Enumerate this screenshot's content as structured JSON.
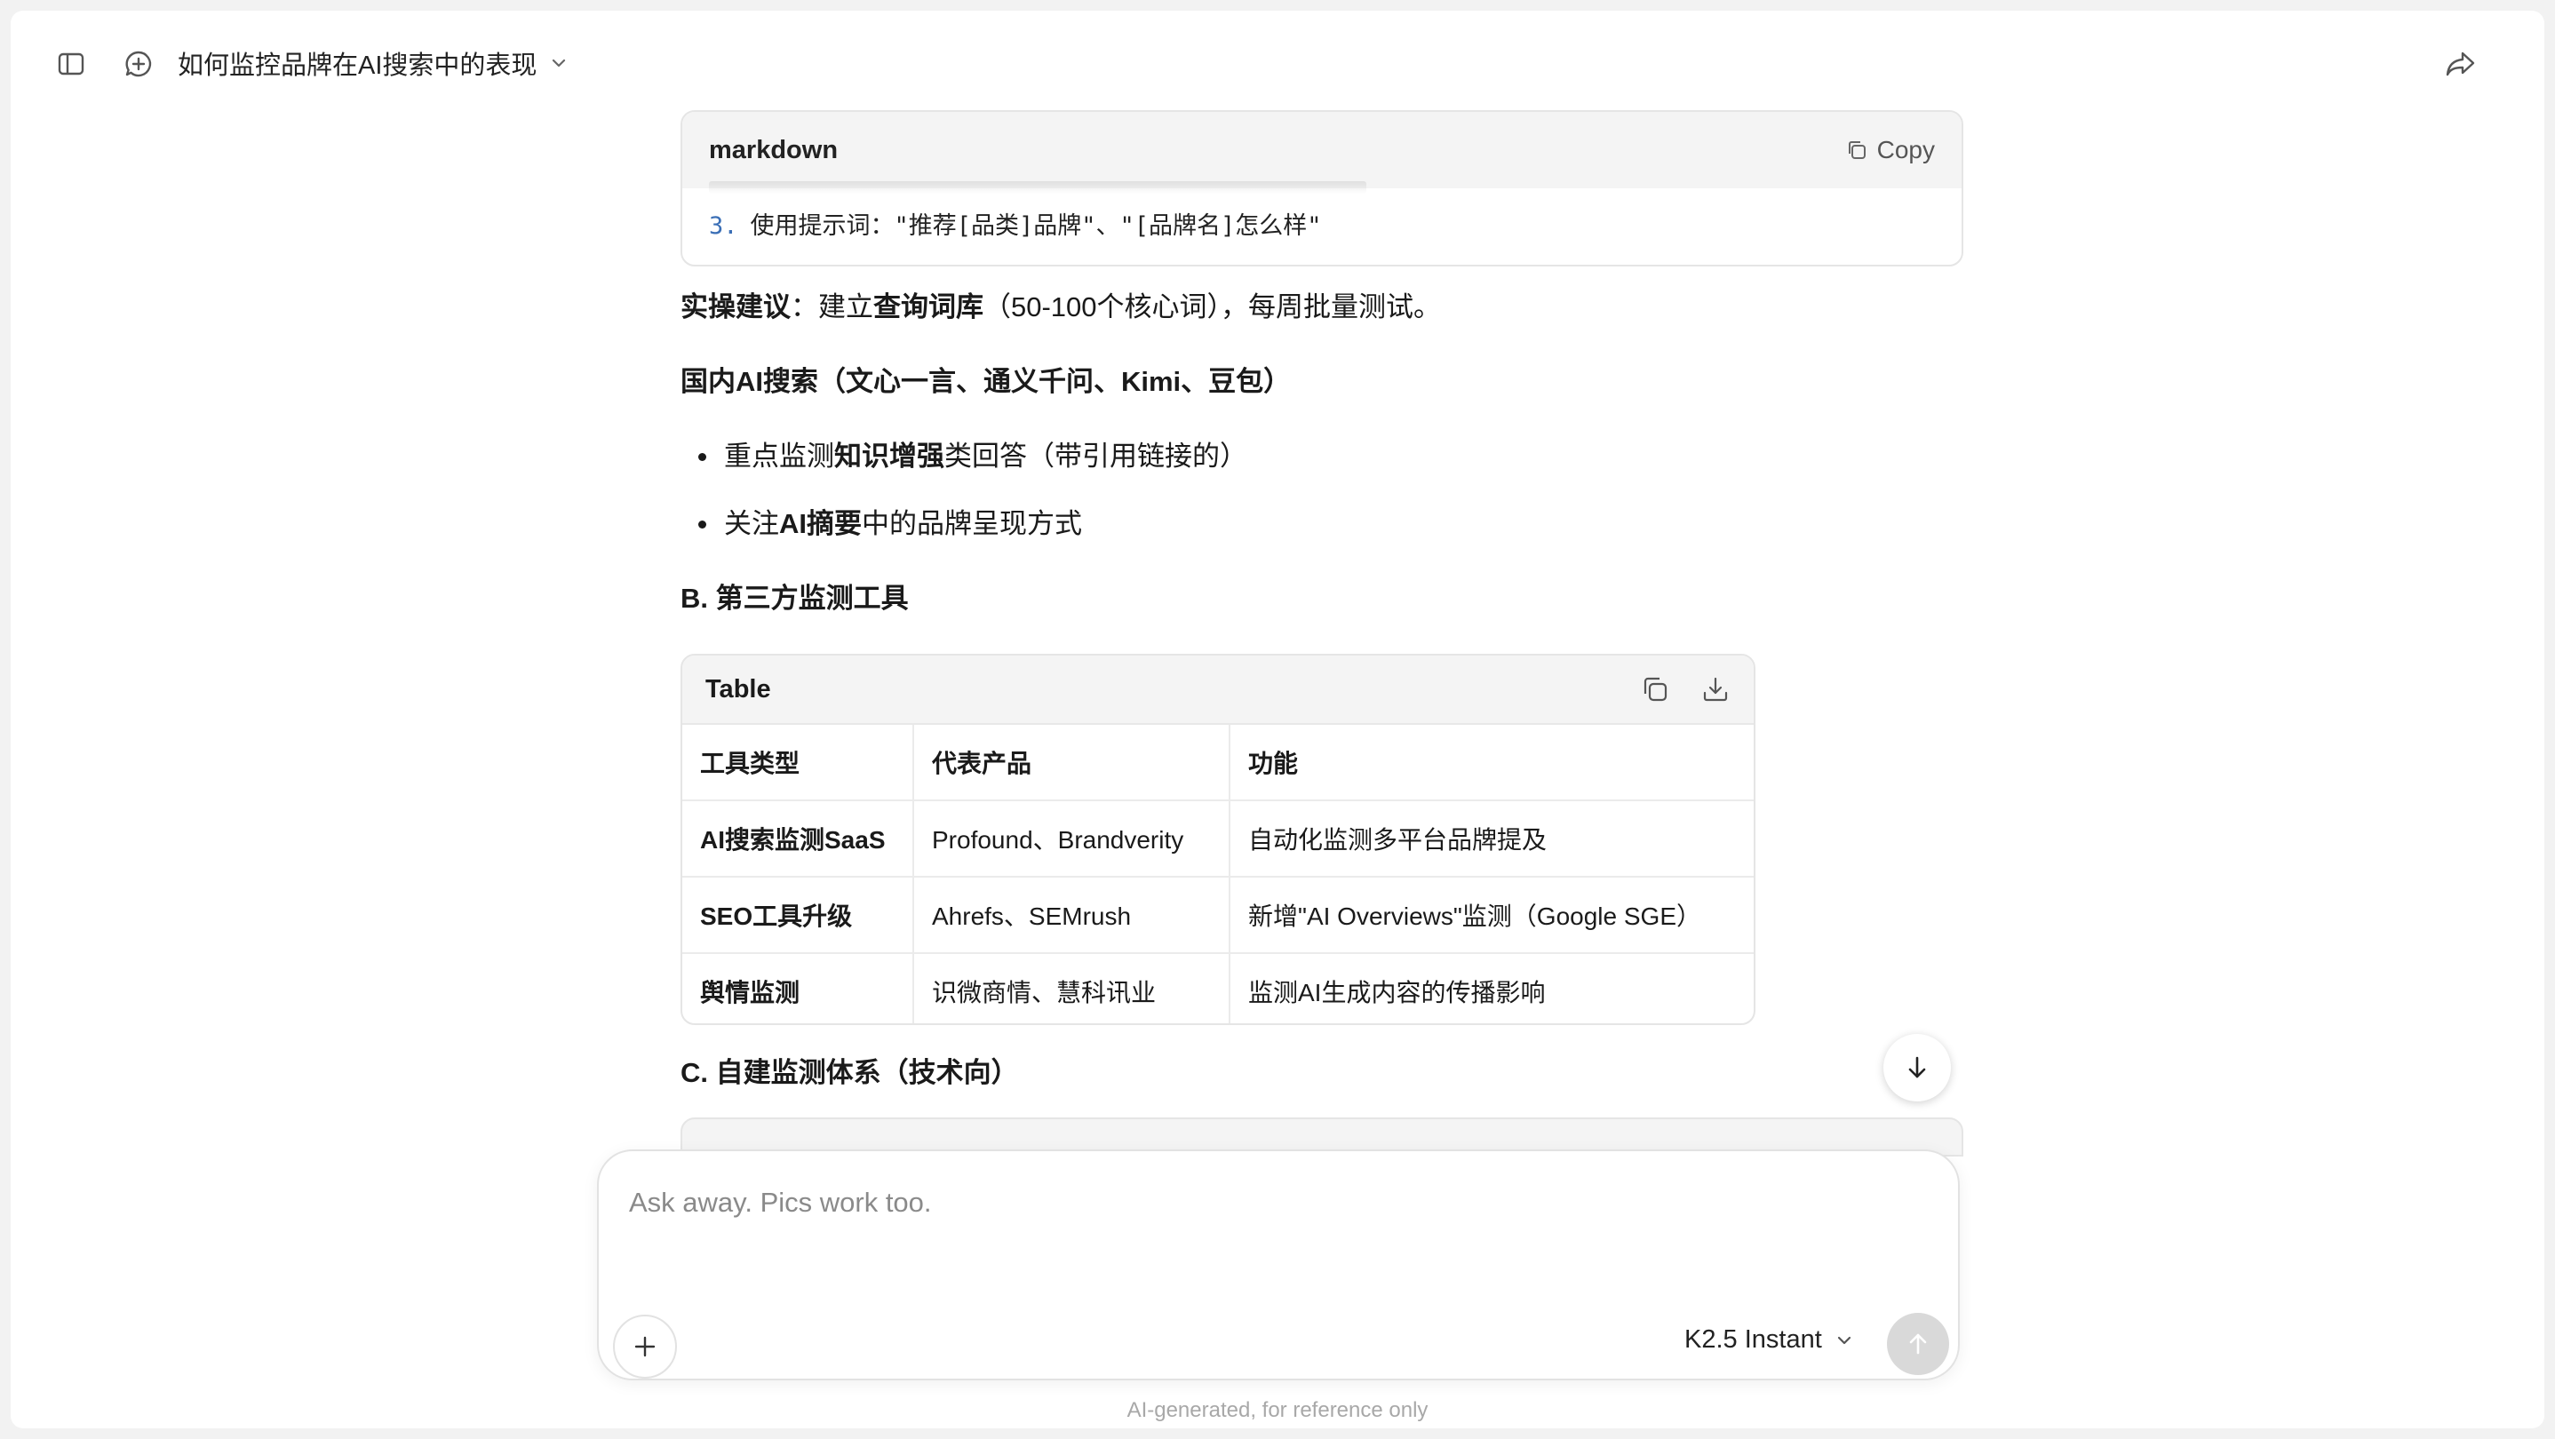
{
  "header": {
    "title": "如何监控品牌在AI搜索中的表现"
  },
  "codeblock": {
    "language": "markdown",
    "copy_label": "Copy",
    "line_number": "3.",
    "line_text": "使用提示词：\"推荐[品类]品牌\"、\"[品牌名]怎么样\""
  },
  "content": {
    "tip": {
      "lead": "实操建议",
      "text1": "：建立",
      "bold": "查询词库",
      "text2": "（50-100个核心词），每周批量测试。"
    },
    "domestic_heading": "国内AI搜索（文心一言、通义千问、Kimi、豆包）",
    "bullets": [
      {
        "pre": "重点监测",
        "bold": "知识增强",
        "post": "类回答（带引用链接的）"
      },
      {
        "pre": "关注",
        "bold": "AI摘要",
        "post": "中的品牌呈现方式"
      }
    ],
    "section_b": "B. 第三方监测工具",
    "section_c": "C. 自建监测体系（技术向）"
  },
  "table": {
    "label": "Table",
    "headers": [
      "工具类型",
      "代表产品",
      "功能"
    ],
    "rows": [
      [
        "AI搜索监测SaaS",
        "Profound、Brandverity",
        "自动化监测多平台品牌提及"
      ],
      [
        "SEO工具升级",
        "Ahrefs、SEMrush",
        "新增\"AI Overviews\"监测（Google SGE）"
      ],
      [
        "舆情监测",
        "识微商情、慧科讯业",
        "监测AI生成内容的传播影响"
      ]
    ]
  },
  "composer": {
    "placeholder": "Ask away. Pics work too.",
    "model": "K2.5 Instant"
  },
  "footer": "AI-generated, for reference only",
  "icons": {
    "sidebar": "sidebar-toggle-icon",
    "new_chat": "new-chat-icon",
    "share": "share-icon",
    "copy": "copy-icon",
    "download": "download-icon",
    "scroll_down": "arrow-down-icon",
    "plus": "plus-icon",
    "send": "arrow-up-icon",
    "chevron": "chevron-down-icon"
  }
}
